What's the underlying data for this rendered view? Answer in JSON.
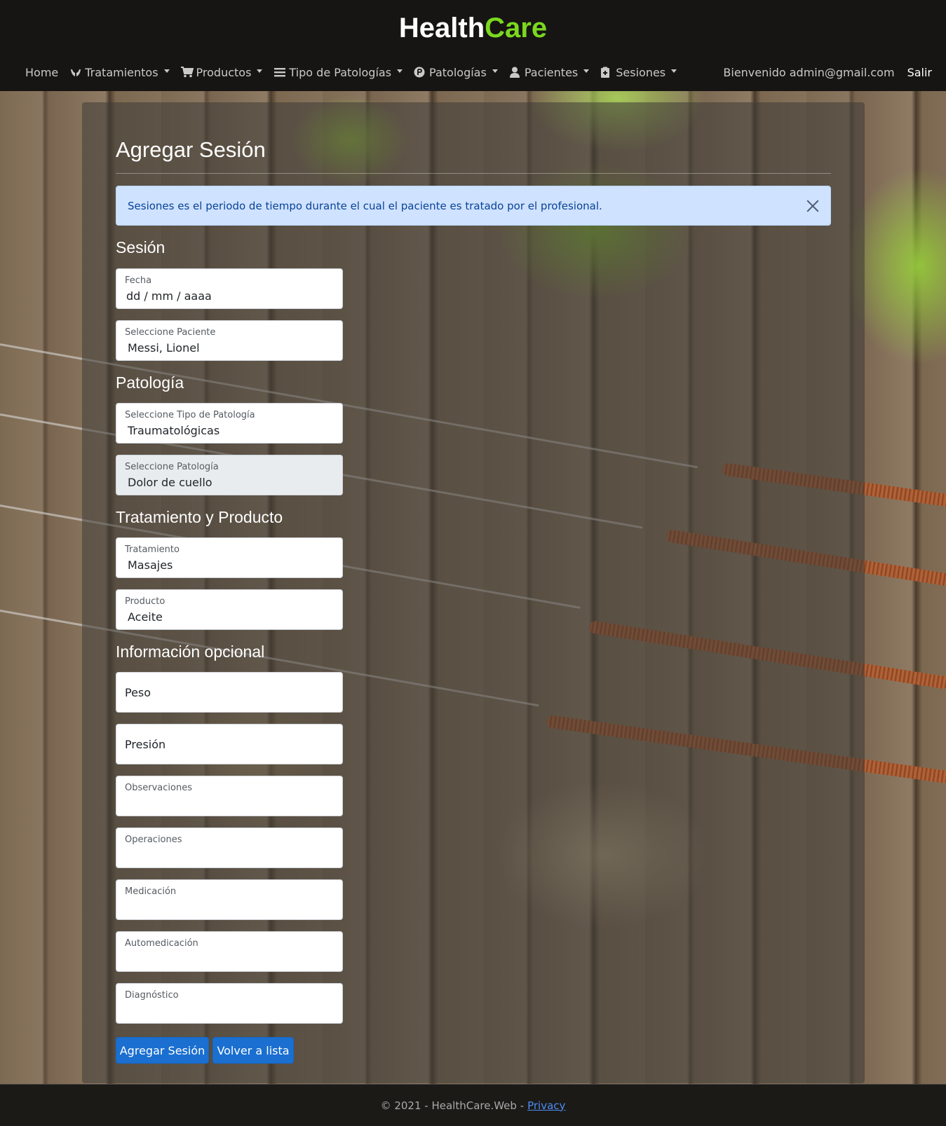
{
  "brand": {
    "part1": "Health",
    "part2": "Care"
  },
  "nav": {
    "items": [
      {
        "label": "Home",
        "icon": "",
        "dropdown": false
      },
      {
        "label": "Tratamientos",
        "icon": "hands-icon",
        "dropdown": true
      },
      {
        "label": "Productos",
        "icon": "cart-icon",
        "dropdown": true
      },
      {
        "label": "Tipo de Patologías",
        "icon": "list-icon",
        "dropdown": true
      },
      {
        "label": "Patologías",
        "icon": "p-circle-icon",
        "dropdown": true
      },
      {
        "label": "Pacientes",
        "icon": "user-icon",
        "dropdown": true
      },
      {
        "label": "Sesiones",
        "icon": "clipboard-icon",
        "dropdown": true
      }
    ],
    "welcome": "Bienvenido admin@gmail.com",
    "logout": "Salir"
  },
  "page": {
    "title": "Agregar Sesión",
    "alert": "Sesiones es el periodo de tiempo durante el cual el paciente es tratado por el profesional."
  },
  "sections": {
    "sesion": "Sesión",
    "patologia": "Patología",
    "tratamiento": "Tratamiento y Producto",
    "opcional": "Información opcional"
  },
  "fields": {
    "fecha": {
      "label": "Fecha",
      "value": "dd / mm / aaaa"
    },
    "paciente": {
      "label": "Seleccione Paciente",
      "value": "Messi, Lionel"
    },
    "tipo_patologia": {
      "label": "Seleccione Tipo de Patología",
      "value": "Traumatológicas"
    },
    "patologia": {
      "label": "Seleccione Patología",
      "value": "Dolor de cuello"
    },
    "tratamiento": {
      "label": "Tratamiento",
      "value": "Masajes"
    },
    "producto": {
      "label": "Producto",
      "value": "Aceite"
    },
    "peso": {
      "placeholder": "Peso"
    },
    "presion": {
      "placeholder": "Presión"
    },
    "observaciones": {
      "label": "Observaciones",
      "value": ""
    },
    "operaciones": {
      "label": "Operaciones",
      "value": ""
    },
    "medicacion": {
      "label": "Medicación",
      "value": ""
    },
    "automedicacion": {
      "label": "Automedicación",
      "value": ""
    },
    "diagnostico": {
      "label": "Diagnóstico",
      "value": ""
    }
  },
  "buttons": {
    "submit": "Agregar Sesión",
    "back": "Volver a lista"
  },
  "footer": {
    "text": "© 2021 - HealthCare.Web -",
    "link": "Privacy"
  },
  "colors": {
    "accent": "#7bd81f",
    "primary": "#1a6fd0",
    "alert_bg": "#cfe2ff"
  }
}
